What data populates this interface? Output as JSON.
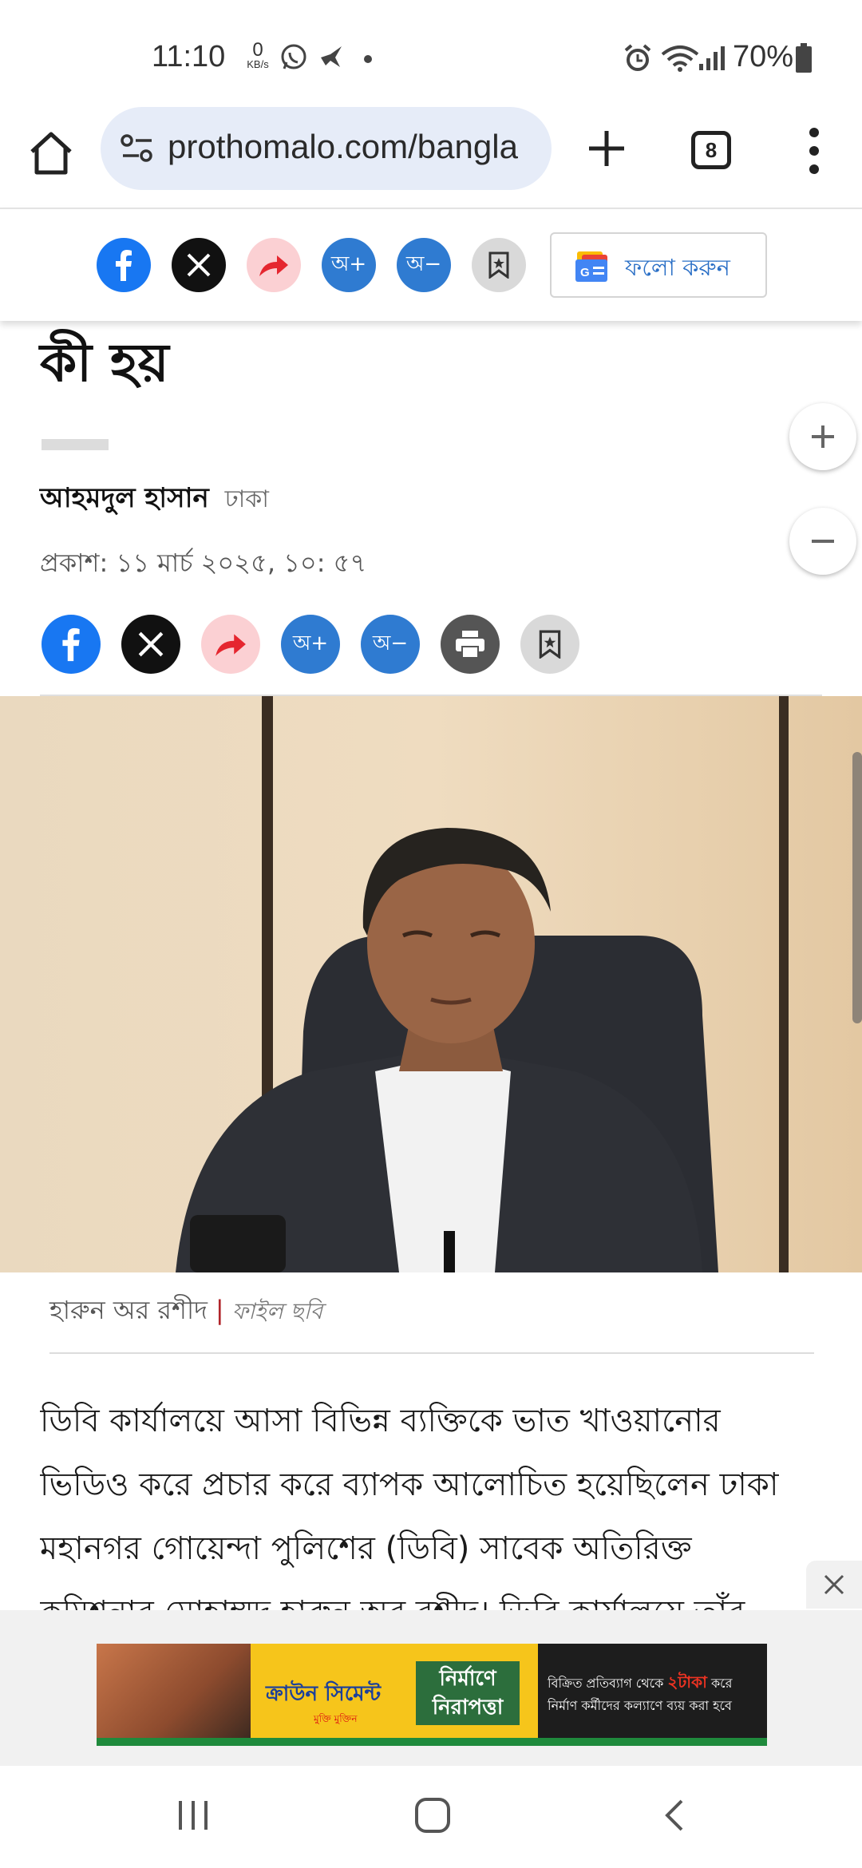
{
  "status_bar": {
    "time": "11:10",
    "net_speed_value": "0",
    "net_speed_unit": "KB/s",
    "battery": "70%"
  },
  "browser": {
    "url": "prothomalo.com/bangla",
    "tab_count": "8"
  },
  "share_toolbar": {
    "font_increase": "অ+",
    "font_decrease": "অ−",
    "follow_label": "ফলো করুন"
  },
  "article": {
    "headline_tail": "কী হয়",
    "author_name": "আহমদুল হাসান",
    "author_location": "ঢাকা",
    "published": "প্রকাশ: ১১ মার্চ ২০২৫, ১০: ৫৭",
    "font_increase": "অ+",
    "font_decrease": "অ−",
    "photo_caption": "হারুন অর রশীদ",
    "photo_source": "ফাইল ছবি",
    "body_lines": [
      "ডিবি কার্যালয়ে আসা বিভিন্ন ব্যক্তিকে ভাত খাওয়ানোর",
      "ভিডিও করে প্রচার করে ব্যাপক আলোচিত হয়েছিলেন ঢাকা",
      "মহানগর গোয়েন্দা পুলিশের (ডিবি) সাবেক অতিরিক্ত",
      "কমিশনার মোহাম্মদ হারুন অর রশীদ। ডিবি কার্যালয়ে তাঁর"
    ]
  },
  "ad": {
    "brand": "ক্রাউন সিমেন্ট",
    "brand_sub": "মুক্তি মুক্তিন",
    "slogan": "নির্মাণে নিরাপত্তা",
    "line1_pre": "বিক্রিত প্রতিব্যাগ থেকে",
    "line1_amount": "২টাকা",
    "line1_post": "করে",
    "line2": "নির্মাণ কর্মীদের কল্যাণে ব্যয় করা হবে"
  },
  "colors": {
    "facebook": "#1877f2",
    "share_pink": "#fbd0d3",
    "font_blue": "#2f7bd1",
    "follow_blue": "#2a6fc6",
    "url_pill": "#e6ecf8"
  }
}
